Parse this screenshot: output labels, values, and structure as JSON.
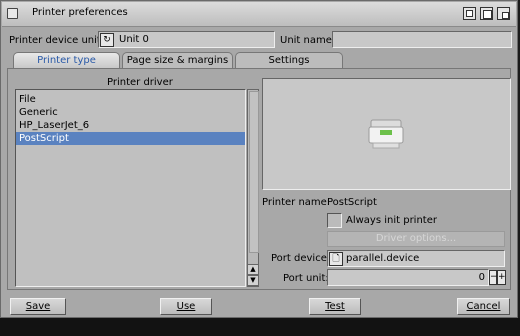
{
  "window": {
    "title": "Printer preferences"
  },
  "top_row": {
    "device_unit_label": "Printer device unit:",
    "device_unit_value": "Unit 0",
    "unit_name_label": "Unit name:",
    "unit_name_value": ""
  },
  "tabs": [
    {
      "label": "Printer type",
      "active": true
    },
    {
      "label": "Page size & margins",
      "active": false
    },
    {
      "label": "Settings",
      "active": false
    }
  ],
  "driver": {
    "heading": "Printer driver",
    "items": [
      "File",
      "Generic",
      "HP_LaserJet_6",
      "PostScript"
    ],
    "selected": "PostScript"
  },
  "details": {
    "printer_name_label": "Printer name:",
    "printer_name_value": "PostScript",
    "always_init_label": "Always init printer",
    "always_init_checked": false,
    "driver_options_label": "Driver options...",
    "port_device_label": "Port device:",
    "port_device_value": "parallel.device",
    "port_unit_label": "Port unit:",
    "port_unit_value": "0"
  },
  "buttons": {
    "save": "Save",
    "use": "Use",
    "test": "Test",
    "cancel": "Cancel"
  },
  "colors": {
    "selection": "#5a82c0",
    "active_tab_text": "#2a5aa8"
  }
}
